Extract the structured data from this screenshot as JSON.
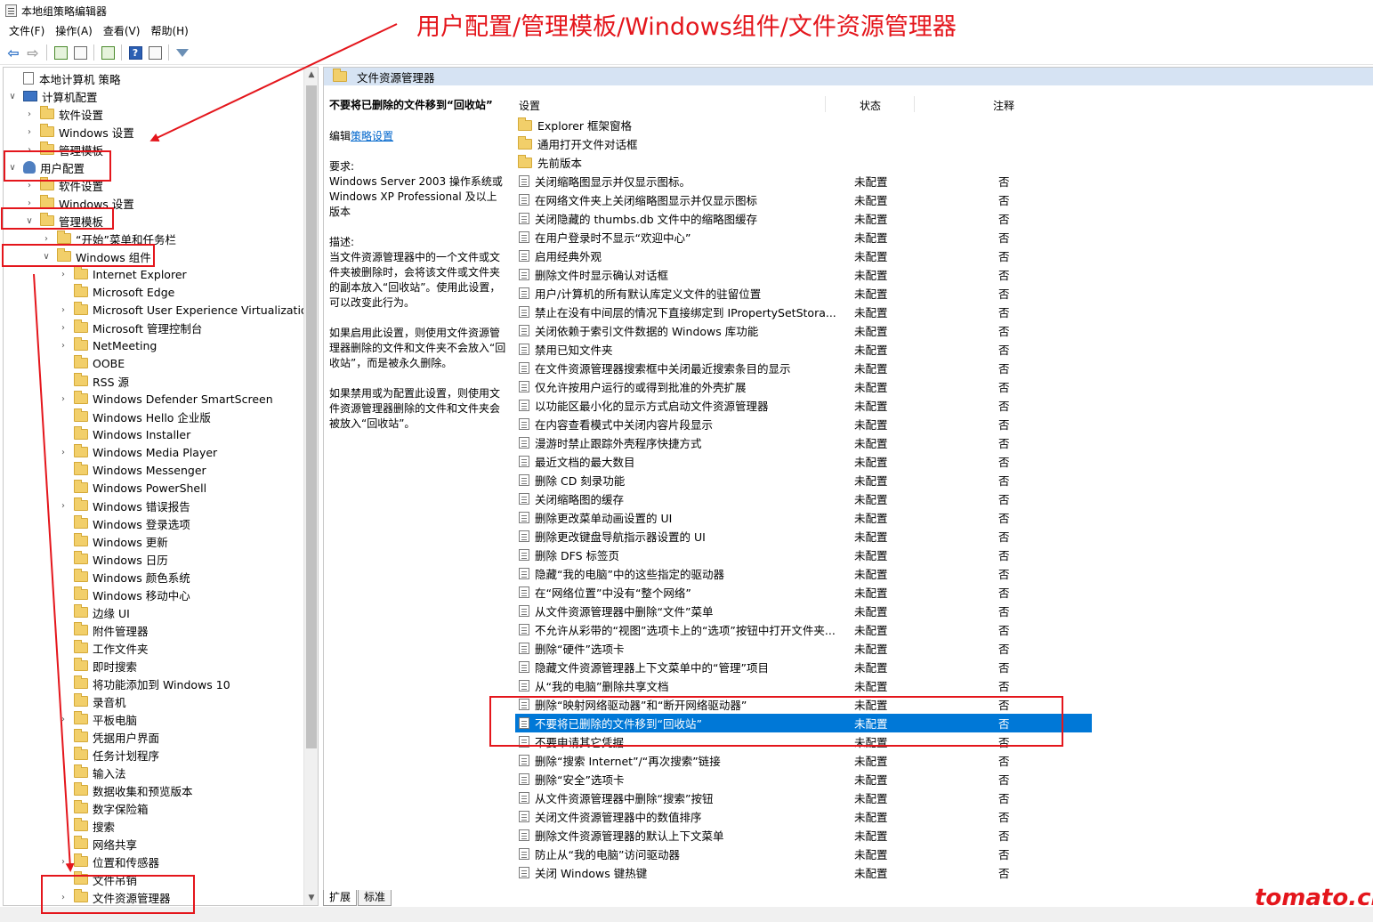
{
  "window": {
    "title": "本地组策略编辑器"
  },
  "menu": [
    "文件(F)",
    "操作(A)",
    "查看(V)",
    "帮助(H)"
  ],
  "toolbar": {
    "icons": [
      "back-arrow-icon",
      "forward-arrow-icon",
      "up-folder-icon",
      "show-hide-tree-icon",
      "export-list-icon",
      "help-icon",
      "properties-icon",
      "filter-icon"
    ],
    "help_glyph": "?"
  },
  "tree": [
    {
      "label": "本地计算机 策略",
      "level": 0,
      "icon": "doc",
      "chev": ""
    },
    {
      "label": "计算机配置",
      "level": 0,
      "icon": "pc",
      "chev": "v"
    },
    {
      "label": "软件设置",
      "level": 1,
      "icon": "folder",
      "chev": ">"
    },
    {
      "label": "Windows 设置",
      "level": 1,
      "icon": "folder",
      "chev": ">"
    },
    {
      "label": "管理模板",
      "level": 1,
      "icon": "folder",
      "chev": ">"
    },
    {
      "label": "用户配置",
      "level": 0,
      "icon": "user",
      "chev": "v"
    },
    {
      "label": "软件设置",
      "level": 1,
      "icon": "folder",
      "chev": ">"
    },
    {
      "label": "Windows 设置",
      "level": 1,
      "icon": "folder",
      "chev": ">"
    },
    {
      "label": "管理模板",
      "level": 1,
      "icon": "folder",
      "chev": "v"
    },
    {
      "label": "“开始”菜单和任务栏",
      "level": 2,
      "icon": "folder",
      "chev": ">"
    },
    {
      "label": "Windows 组件",
      "level": 2,
      "icon": "folder",
      "chev": "v"
    },
    {
      "label": "Internet Explorer",
      "level": 3,
      "icon": "folder",
      "chev": ">"
    },
    {
      "label": "Microsoft Edge",
      "level": 3,
      "icon": "folder",
      "chev": ""
    },
    {
      "label": "Microsoft User Experience Virtualization",
      "level": 3,
      "icon": "folder",
      "chev": ">"
    },
    {
      "label": "Microsoft 管理控制台",
      "level": 3,
      "icon": "folder",
      "chev": ">"
    },
    {
      "label": "NetMeeting",
      "level": 3,
      "icon": "folder",
      "chev": ">"
    },
    {
      "label": "OOBE",
      "level": 3,
      "icon": "folder",
      "chev": ""
    },
    {
      "label": "RSS 源",
      "level": 3,
      "icon": "folder",
      "chev": ""
    },
    {
      "label": "Windows Defender SmartScreen",
      "level": 3,
      "icon": "folder",
      "chev": ">"
    },
    {
      "label": "Windows Hello 企业版",
      "level": 3,
      "icon": "folder",
      "chev": ""
    },
    {
      "label": "Windows Installer",
      "level": 3,
      "icon": "folder",
      "chev": ""
    },
    {
      "label": "Windows Media Player",
      "level": 3,
      "icon": "folder",
      "chev": ">"
    },
    {
      "label": "Windows Messenger",
      "level": 3,
      "icon": "folder",
      "chev": ""
    },
    {
      "label": "Windows PowerShell",
      "level": 3,
      "icon": "folder",
      "chev": ""
    },
    {
      "label": "Windows 错误报告",
      "level": 3,
      "icon": "folder",
      "chev": ">"
    },
    {
      "label": "Windows 登录选项",
      "level": 3,
      "icon": "folder",
      "chev": ""
    },
    {
      "label": "Windows 更新",
      "level": 3,
      "icon": "folder",
      "chev": ""
    },
    {
      "label": "Windows 日历",
      "level": 3,
      "icon": "folder",
      "chev": ""
    },
    {
      "label": "Windows 颜色系统",
      "level": 3,
      "icon": "folder",
      "chev": ""
    },
    {
      "label": "Windows 移动中心",
      "level": 3,
      "icon": "folder",
      "chev": ""
    },
    {
      "label": "边缘 UI",
      "level": 3,
      "icon": "folder",
      "chev": ""
    },
    {
      "label": "附件管理器",
      "level": 3,
      "icon": "folder",
      "chev": ""
    },
    {
      "label": "工作文件夹",
      "level": 3,
      "icon": "folder",
      "chev": ""
    },
    {
      "label": "即时搜索",
      "level": 3,
      "icon": "folder",
      "chev": ""
    },
    {
      "label": "将功能添加到 Windows 10",
      "level": 3,
      "icon": "folder",
      "chev": ""
    },
    {
      "label": "录音机",
      "level": 3,
      "icon": "folder",
      "chev": ""
    },
    {
      "label": "平板电脑",
      "level": 3,
      "icon": "folder",
      "chev": ">"
    },
    {
      "label": "凭据用户界面",
      "level": 3,
      "icon": "folder",
      "chev": ""
    },
    {
      "label": "任务计划程序",
      "level": 3,
      "icon": "folder",
      "chev": ""
    },
    {
      "label": "输入法",
      "level": 3,
      "icon": "folder",
      "chev": ""
    },
    {
      "label": "数据收集和预览版本",
      "level": 3,
      "icon": "folder",
      "chev": ""
    },
    {
      "label": "数字保险箱",
      "level": 3,
      "icon": "folder",
      "chev": ""
    },
    {
      "label": "搜索",
      "level": 3,
      "icon": "folder",
      "chev": ""
    },
    {
      "label": "网络共享",
      "level": 3,
      "icon": "folder",
      "chev": ""
    },
    {
      "label": "位置和传感器",
      "level": 3,
      "icon": "folder",
      "chev": ">"
    },
    {
      "label": "文件吊销",
      "level": 3,
      "icon": "folder",
      "chev": ""
    },
    {
      "label": "文件资源管理器",
      "level": 3,
      "icon": "folder",
      "chev": ">"
    }
  ],
  "right_header": {
    "title": "文件资源管理器"
  },
  "description": {
    "heading": "不要将已删除的文件移到“回收站”",
    "edit_prefix": "编辑",
    "edit_link": "策略设置",
    "req_label": "要求:",
    "req_text": "Windows Server 2003 操作系统或 Windows XP Professional 及以上版本",
    "desc_label": "描述:",
    "desc_text": "当文件资源管理器中的一个文件或文件夹被删除时，会将该文件或文件夹的副本放入“回收站”。使用此设置，可以改变此行为。",
    "enabled_text": "如果启用此设置，则使用文件资源管理器删除的文件和文件夹不会放入“回收站”，而是被永久删除。",
    "disabled_text": "如果禁用或为配置此设置，则使用文件资源管理器删除的文件和文件夹会被放入“回收站”。"
  },
  "columns": {
    "setting": "设置",
    "state": "状态",
    "note": "注释"
  },
  "settings": [
    {
      "name": "Explorer 框架窗格",
      "type": "folder",
      "state": "",
      "note": ""
    },
    {
      "name": "通用打开文件对话框",
      "type": "folder",
      "state": "",
      "note": ""
    },
    {
      "name": "先前版本",
      "type": "folder",
      "state": "",
      "note": ""
    },
    {
      "name": "关闭缩略图显示并仅显示图标。",
      "type": "policy",
      "state": "未配置",
      "note": "否"
    },
    {
      "name": "在网络文件夹上关闭缩略图显示并仅显示图标",
      "type": "policy",
      "state": "未配置",
      "note": "否"
    },
    {
      "name": "关闭隐藏的 thumbs.db 文件中的缩略图缓存",
      "type": "policy",
      "state": "未配置",
      "note": "否"
    },
    {
      "name": "在用户登录时不显示“欢迎中心”",
      "type": "policy",
      "state": "未配置",
      "note": "否"
    },
    {
      "name": "启用经典外观",
      "type": "policy",
      "state": "未配置",
      "note": "否"
    },
    {
      "name": "删除文件时显示确认对话框",
      "type": "policy",
      "state": "未配置",
      "note": "否"
    },
    {
      "name": "用户/计算机的所有默认库定义文件的驻留位置",
      "type": "policy",
      "state": "未配置",
      "note": "否"
    },
    {
      "name": "禁止在没有中间层的情况下直接绑定到 IPropertySetStora...",
      "type": "policy",
      "state": "未配置",
      "note": "否"
    },
    {
      "name": "关闭依赖于索引文件数据的 Windows 库功能",
      "type": "policy",
      "state": "未配置",
      "note": "否"
    },
    {
      "name": "禁用已知文件夹",
      "type": "policy",
      "state": "未配置",
      "note": "否"
    },
    {
      "name": "在文件资源管理器搜索框中关闭最近搜索条目的显示",
      "type": "policy",
      "state": "未配置",
      "note": "否"
    },
    {
      "name": "仅允许按用户运行的或得到批准的外壳扩展",
      "type": "policy",
      "state": "未配置",
      "note": "否"
    },
    {
      "name": "以功能区最小化的显示方式启动文件资源管理器",
      "type": "policy",
      "state": "未配置",
      "note": "否"
    },
    {
      "name": "在内容查看模式中关闭内容片段显示",
      "type": "policy",
      "state": "未配置",
      "note": "否"
    },
    {
      "name": "漫游时禁止跟踪外壳程序快捷方式",
      "type": "policy",
      "state": "未配置",
      "note": "否"
    },
    {
      "name": "最近文档的最大数目",
      "type": "policy",
      "state": "未配置",
      "note": "否"
    },
    {
      "name": "删除 CD 刻录功能",
      "type": "policy",
      "state": "未配置",
      "note": "否"
    },
    {
      "name": "关闭缩略图的缓存",
      "type": "policy",
      "state": "未配置",
      "note": "否"
    },
    {
      "name": "删除更改菜单动画设置的 UI",
      "type": "policy",
      "state": "未配置",
      "note": "否"
    },
    {
      "name": "删除更改键盘导航指示器设置的 UI",
      "type": "policy",
      "state": "未配置",
      "note": "否"
    },
    {
      "name": "删除 DFS 标签页",
      "type": "policy",
      "state": "未配置",
      "note": "否"
    },
    {
      "name": "隐藏“我的电脑”中的这些指定的驱动器",
      "type": "policy",
      "state": "未配置",
      "note": "否"
    },
    {
      "name": "在“网络位置”中没有“整个网络”",
      "type": "policy",
      "state": "未配置",
      "note": "否"
    },
    {
      "name": "从文件资源管理器中删除“文件”菜单",
      "type": "policy",
      "state": "未配置",
      "note": "否"
    },
    {
      "name": "不允许从彩带的“视图”选项卡上的“选项”按钮中打开文件夹...",
      "type": "policy",
      "state": "未配置",
      "note": "否"
    },
    {
      "name": "删除“硬件”选项卡",
      "type": "policy",
      "state": "未配置",
      "note": "否"
    },
    {
      "name": "隐藏文件资源管理器上下文菜单中的“管理”项目",
      "type": "policy",
      "state": "未配置",
      "note": "否"
    },
    {
      "name": "从“我的电脑”删除共享文档",
      "type": "policy",
      "state": "未配置",
      "note": "否"
    },
    {
      "name": "删除“映射网络驱动器”和“断开网络驱动器”",
      "type": "policy",
      "state": "未配置",
      "note": "否"
    },
    {
      "name": "不要将已删除的文件移到“回收站”",
      "type": "policy",
      "state": "未配置",
      "note": "否",
      "selected": true
    },
    {
      "name": "不要申请其它凭据",
      "type": "policy",
      "state": "未配置",
      "note": "否"
    },
    {
      "name": "删除“搜索 Internet”/“再次搜索”链接",
      "type": "policy",
      "state": "未配置",
      "note": "否"
    },
    {
      "name": "删除“安全”选项卡",
      "type": "policy",
      "state": "未配置",
      "note": "否"
    },
    {
      "name": "从文件资源管理器中删除“搜索”按钮",
      "type": "policy",
      "state": "未配置",
      "note": "否"
    },
    {
      "name": "关闭文件资源管理器中的数值排序",
      "type": "policy",
      "state": "未配置",
      "note": "否"
    },
    {
      "name": "删除文件资源管理器的默认上下文菜单",
      "type": "policy",
      "state": "未配置",
      "note": "否"
    },
    {
      "name": "防止从“我的电脑”访问驱动器",
      "type": "policy",
      "state": "未配置",
      "note": "否"
    },
    {
      "name": "关闭 Windows 键热键",
      "type": "policy",
      "state": "未配置",
      "note": "否"
    }
  ],
  "bottom_tabs": [
    "扩展",
    "标准"
  ],
  "annotation": {
    "title": "用户配置/管理模板/Windows组件/文件资源管理器",
    "color": "#e4161c"
  },
  "watermark": "tomato.cm",
  "colors": {
    "selection": "#0078d7",
    "header_bg": "#d6e3f3",
    "link": "#0066cc"
  }
}
